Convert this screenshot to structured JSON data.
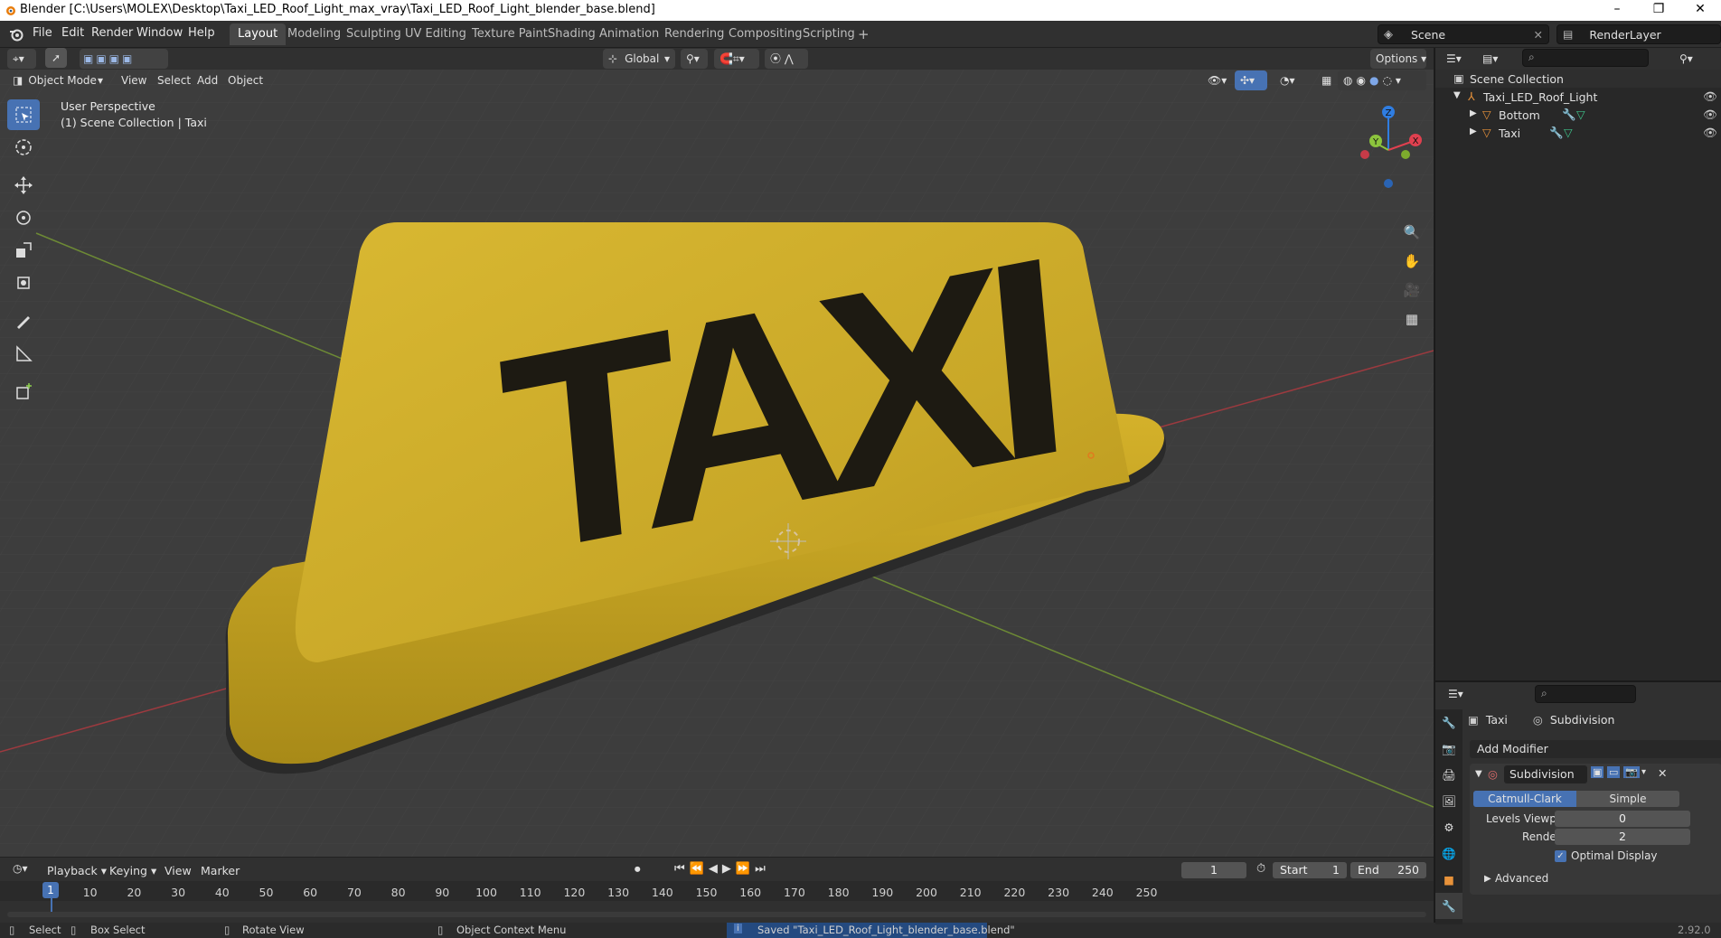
{
  "window": {
    "title": "Blender [C:\\Users\\MOLEX\\Desktop\\Taxi_LED_Roof_Light_max_vray\\Taxi_LED_Roof_Light_blender_base.blend]",
    "minimize": "–",
    "restore": "❐",
    "close": "✕"
  },
  "menu": [
    "File",
    "Edit",
    "Render",
    "Window",
    "Help"
  ],
  "workspaces": [
    "Layout",
    "Modeling",
    "Sculpting",
    "UV Editing",
    "Texture Paint",
    "Shading",
    "Animation",
    "Rendering",
    "Compositing",
    "Scripting"
  ],
  "workspace_add": "+",
  "scene": {
    "label": "Scene",
    "render_layer": "RenderLayer"
  },
  "viewport": {
    "mode": "Object Mode",
    "menus": [
      "View",
      "Select",
      "Add",
      "Object"
    ],
    "transform_orientation": "Global",
    "options": "Options",
    "perspective": "User Perspective",
    "collection_info": "(1) Scene Collection | Taxi",
    "object_text": "TAXI",
    "gizmo": {
      "z": "Z",
      "y": "Y",
      "x": "X"
    }
  },
  "outliner": {
    "root": "Scene Collection",
    "collection": "Taxi_LED_Roof_Light",
    "objects": [
      "Bottom",
      "Taxi"
    ]
  },
  "properties": {
    "object": "Taxi",
    "modifier_tab": "Subdivision",
    "add_modifier": "Add Modifier",
    "modifier_name": "Subdivision",
    "type_options": [
      "Catmull-Clark",
      "Simple"
    ],
    "active_type": "Catmull-Clark",
    "levels_viewport_label": "Levels Viewport",
    "levels_viewport": "0",
    "render_label": "Render",
    "render": "2",
    "optimal_display": "Optimal Display",
    "advanced": "Advanced"
  },
  "timeline": {
    "menus": [
      "Playback",
      "Keying",
      "View",
      "Marker"
    ],
    "current_frame": "1",
    "start_label": "Start",
    "start": "1",
    "end_label": "End",
    "end": "250",
    "ruler": [
      "10",
      "20",
      "30",
      "40",
      "50",
      "60",
      "70",
      "80",
      "90",
      "100",
      "110",
      "120",
      "130",
      "140",
      "150",
      "160",
      "170",
      "180",
      "190",
      "200",
      "210",
      "220",
      "230",
      "240",
      "250"
    ]
  },
  "status": {
    "select": "Select",
    "box_select": "Box Select",
    "rotate_view": "Rotate View",
    "context_menu": "Object Context Menu",
    "saved": "Saved \"Taxi_LED_Roof_Light_blender_base.blend\"",
    "version": "2.92.0"
  },
  "colors": {
    "accent": "#4772b3",
    "yellow": "#d4b21e",
    "x_axis": "#e0404f",
    "y_axis": "#8cc43d",
    "z_axis": "#2f7de1"
  }
}
